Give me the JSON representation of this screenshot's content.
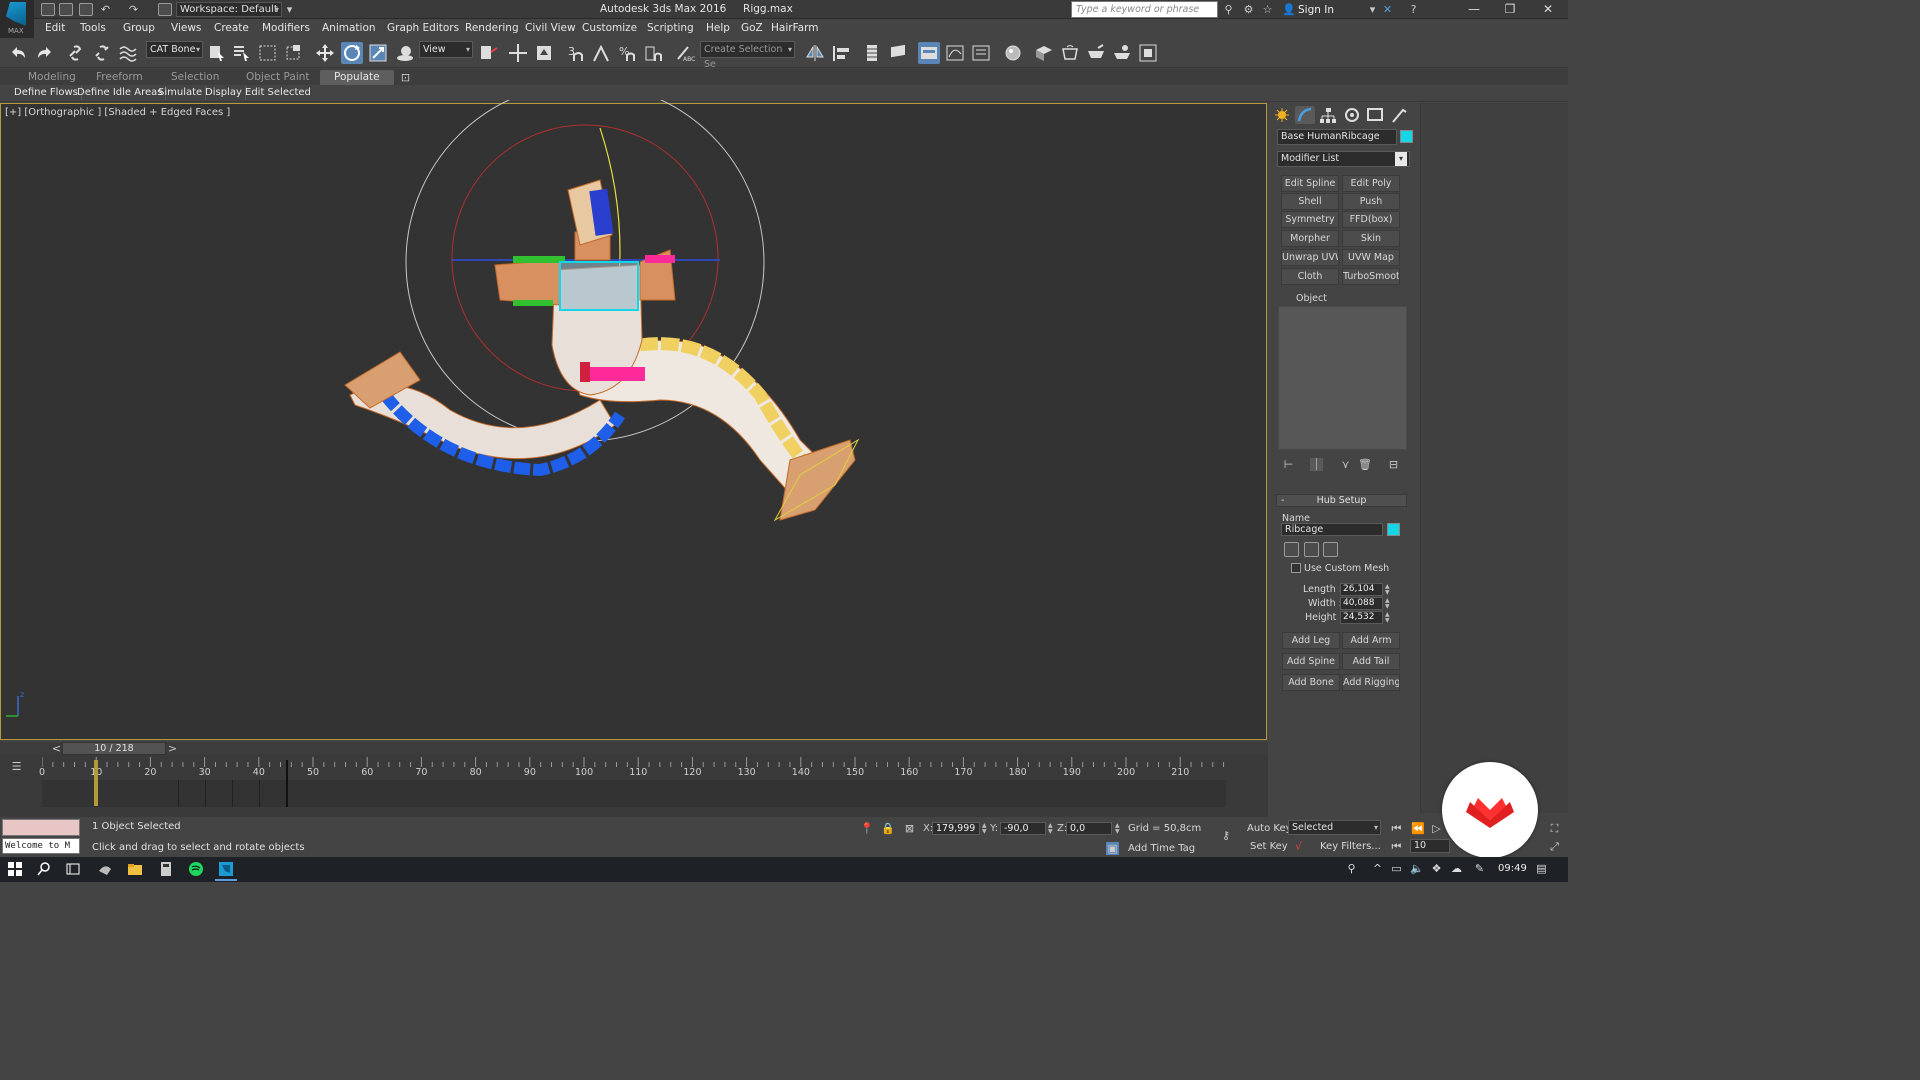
{
  "app": {
    "window_title": "Autodesk 3ds Max 2016",
    "file_name": "Rigg.max",
    "workspace": "Workspace: Default",
    "search_placeholder": "Type a keyword or phrase",
    "sign_in": "Sign In",
    "logo_text": "MAX"
  },
  "menu": [
    "Edit",
    "Tools",
    "Group",
    "Views",
    "Create",
    "Modifiers",
    "Animation",
    "Graph Editors",
    "Rendering",
    "Civil View",
    "Customize",
    "Scripting",
    "Help",
    "GoZ",
    "HairFarm"
  ],
  "toolbar": {
    "selection_filter": "CAT Bone",
    "ref_coord": "View",
    "named_selection": "Create Selection Se"
  },
  "ribbon": {
    "tabs": [
      "Modeling",
      "Freeform",
      "Selection",
      "Object Paint",
      "Populate"
    ],
    "active_tab": "Populate",
    "populate_buttons": [
      "Define Flows",
      "Define Idle Areas",
      "Simulate",
      "Display",
      "Edit Selected"
    ]
  },
  "viewport": {
    "label": "[+] [Orthographic ] [Shaded + Edged Faces ]"
  },
  "command_panel": {
    "object_name": "Base HumanRibcage",
    "object_color": "#14d6e6",
    "modifier_list": "Modifier List",
    "modifier_buttons": [
      "Edit Spline",
      "Edit Poly",
      "Shell",
      "Push",
      "Symmetry",
      "FFD(box)",
      "Morpher",
      "Skin",
      "Unwrap UVW",
      "UVW Map",
      "Cloth",
      "TurboSmooth"
    ],
    "stack_header": "Object",
    "hub_setup": {
      "title": "Hub Setup",
      "name_label": "Name",
      "name_value": "Ribcage",
      "use_custom_mesh": "Use Custom Mesh",
      "length_label": "Length :",
      "length": "26,104",
      "width_label": "Width :",
      "width": "40,088",
      "height_label": "Height :",
      "height": "24,532",
      "buttons": [
        "Add Leg",
        "Add Arm",
        "Add Spine",
        "Add Tail",
        "Add Bone",
        "Add Rigging"
      ]
    }
  },
  "timeline": {
    "slider_text": "10 / 218",
    "current_frame": 10,
    "ticks": [
      "0",
      "10",
      "20",
      "30",
      "40",
      "50",
      "60",
      "70",
      "80",
      "90",
      "100",
      "110",
      "120",
      "130",
      "140",
      "150",
      "160",
      "170",
      "180",
      "190",
      "200",
      "210"
    ]
  },
  "status": {
    "maxscript": "Welcome to M",
    "selection": "1 Object Selected",
    "prompt": "Click and drag to select and rotate objects",
    "x_label": "X:",
    "x": "179,999",
    "y_label": "Y:",
    "y": "-90,0",
    "z_label": "Z:",
    "z": "0,0",
    "grid": "Grid = 50,8cm",
    "add_time_tag": "Add Time Tag",
    "auto_key": "Auto Key",
    "set_key": "Set Key",
    "key_mode": "Selected",
    "key_filters": "Key Filters...",
    "frame_field": "10"
  },
  "taskbar": {
    "clock": "09:49"
  }
}
